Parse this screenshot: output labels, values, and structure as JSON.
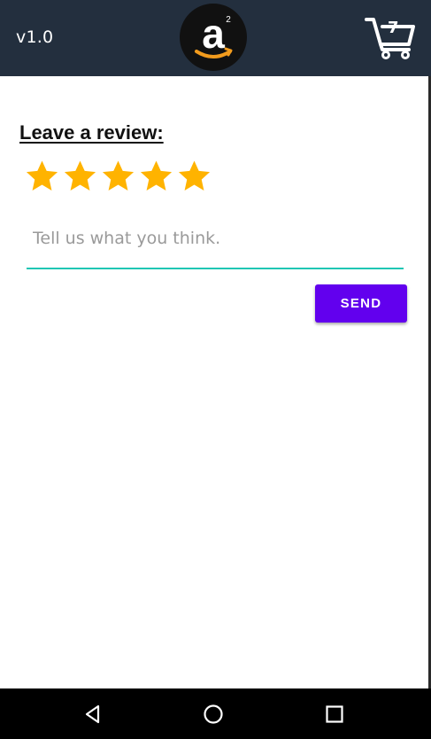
{
  "appbar": {
    "version": "v1.0",
    "logo_letter": "a",
    "logo_superscript": "2",
    "cart_count": "7",
    "background_color": "#232f3e"
  },
  "review": {
    "title": "Leave a review:",
    "rating": 5,
    "max_rating": 5,
    "star_color": "#ffb300",
    "input_placeholder": "Tell us what you think.",
    "input_value": "",
    "underline_color": "#1fc6b4",
    "send_label": "SEND",
    "send_color": "#6200ee"
  },
  "navbar": {
    "icons": [
      "back-icon",
      "home-icon",
      "recents-icon"
    ]
  }
}
